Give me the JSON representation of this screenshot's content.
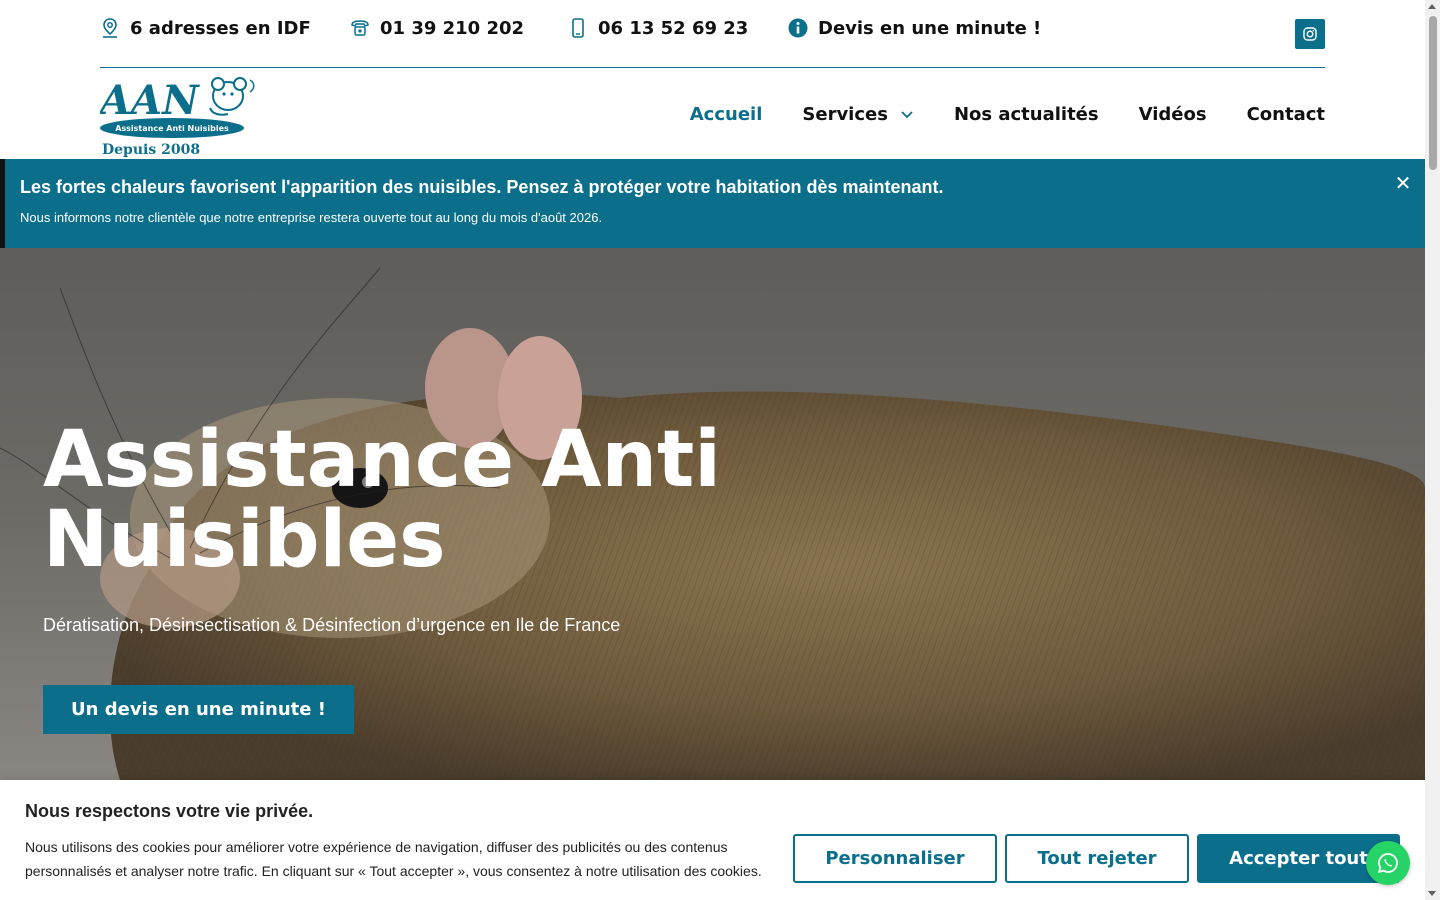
{
  "topbar": {
    "addresses": {
      "icon": "location-pin-icon",
      "label": "6 adresses en IDF"
    },
    "landline": {
      "icon": "phone-icon",
      "label": "01 39 210 202"
    },
    "mobile": {
      "icon": "mobile-phone-icon",
      "label": "06 13 52 69 23"
    },
    "quote": {
      "icon": "info-icon",
      "label": "Devis en une minute !"
    },
    "social": {
      "icon": "instagram-icon"
    }
  },
  "logo": {
    "letters": "AAN",
    "tagline": "Assistance Anti Nuisibles",
    "since": "Depuis 2008"
  },
  "nav": {
    "items": [
      {
        "label": "Accueil",
        "active": true
      },
      {
        "label": "Services",
        "has_dropdown": true
      },
      {
        "label": "Nos actualités"
      },
      {
        "label": "Vidéos"
      },
      {
        "label": "Contact"
      }
    ]
  },
  "alert": {
    "title": " Les fortes chaleurs favorisent l'apparition des nuisibles. Pensez à protéger votre habitation dès maintenant.",
    "message": "Nous informons notre clientèle que notre entreprise restera ouverte tout au long du mois d'août 2026.",
    "close": "✕"
  },
  "hero": {
    "title_line1": "Assistance Anti",
    "title_line2": "Nuisibles",
    "subtitle": "Dératisation, Désinsectisation & Désinfection d’urgence en Ile de France",
    "cta": "Un devis en une minute !"
  },
  "cookie": {
    "title": "Nous respectons votre vie privée.",
    "text": "Nous utilisons des cookies pour améliorer votre expérience de navigation, diffuser des publicités ou des contenus personnalisés et analyser notre trafic. En cliquant sur « Tout accepter », vous consentez à notre utilisation des cookies.",
    "customize": "Personnaliser",
    "reject": "Tout rejeter",
    "accept": "Accepter tout"
  },
  "colors": {
    "brand": "#0b6f8c",
    "whatsapp": "#25d366"
  }
}
